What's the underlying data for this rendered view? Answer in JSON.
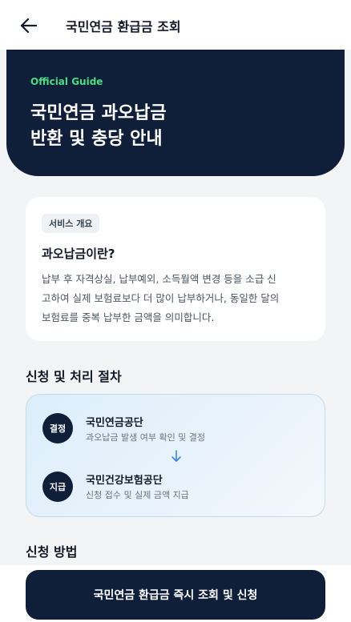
{
  "header": {
    "title": "국민연금 환급금 조회",
    "back_icon": "arrow-left-icon"
  },
  "hero": {
    "tag": "Official Guide",
    "title_line1": "국민연금 과오납금",
    "title_line2": "반환 및 충당 안내",
    "background": "#0f1f3a",
    "tag_color": "#4ade80"
  },
  "overview": {
    "chip": "서비스 개요",
    "title": "과오납금이란?",
    "body_line1": "납부 후 자격상실, 납부예외, 소득월액 변경 등을 소급 신",
    "body_line2": "고하여 실제 보험료보다 더 많이 납부하거나, 동일한 달의",
    "body_line3": "보험료를 중복 납부한 금액을 의미합니다."
  },
  "process": {
    "section_title": "신청 및 처리 절차",
    "steps": [
      {
        "badge": "결정",
        "org": "국민연금공단",
        "desc": "과오납금 발생 여부 확인 및 결정"
      },
      {
        "badge": "지급",
        "org": "국민건강보험공단",
        "desc": "신청 접수 및 실제 금액 지급"
      }
    ],
    "arrow_icon": "arrow-down-icon",
    "arrow_color": "#3b82f6"
  },
  "method": {
    "section_title": "신청 방법"
  },
  "cta": {
    "label": "국민연금 환급금 즉시 조회 및 신청"
  }
}
